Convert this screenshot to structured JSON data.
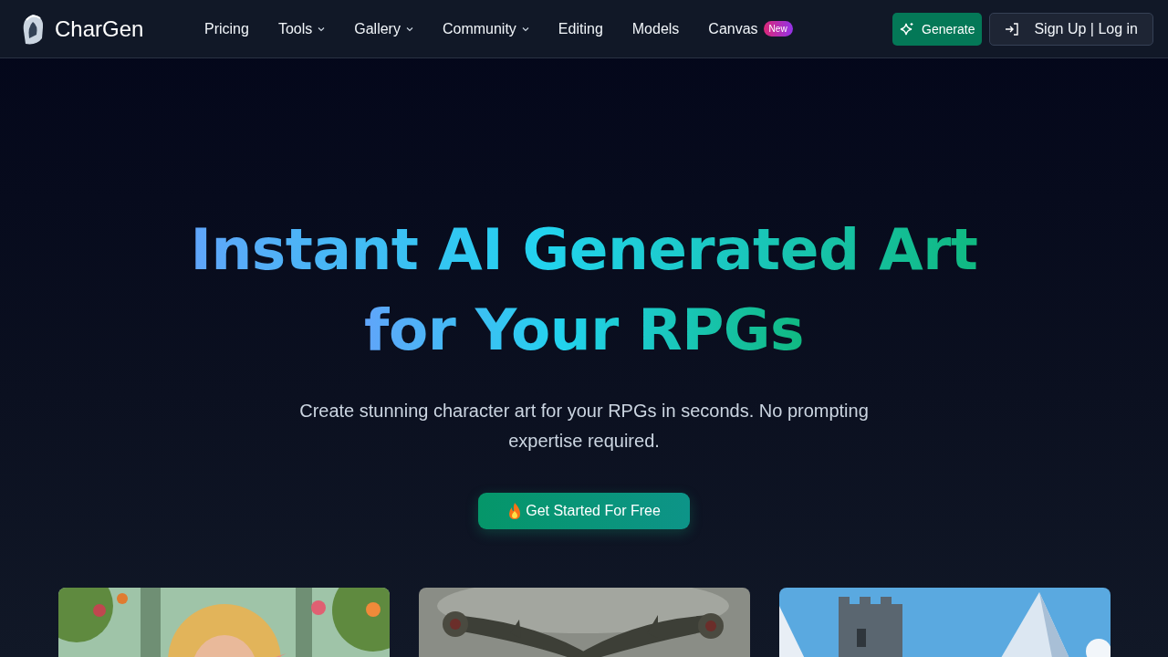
{
  "brand": {
    "name": "CharGen"
  },
  "nav": [
    {
      "label": "Pricing",
      "dropdown": false
    },
    {
      "label": "Tools",
      "dropdown": true
    },
    {
      "label": "Gallery",
      "dropdown": true
    },
    {
      "label": "Community",
      "dropdown": true
    },
    {
      "label": "Editing",
      "dropdown": false
    },
    {
      "label": "Models",
      "dropdown": false
    },
    {
      "label": "Canvas",
      "dropdown": false,
      "badge": "New"
    }
  ],
  "actions": {
    "generate": "Generate",
    "login": "Sign Up | Log in"
  },
  "hero": {
    "title_lines": [
      "Instant AI Generated Art",
      "for Your RPGs"
    ],
    "subtitle": "Create stunning character art for your RPGs in seconds. No prompting expertise required.",
    "cta": "Get Started For Free"
  }
}
